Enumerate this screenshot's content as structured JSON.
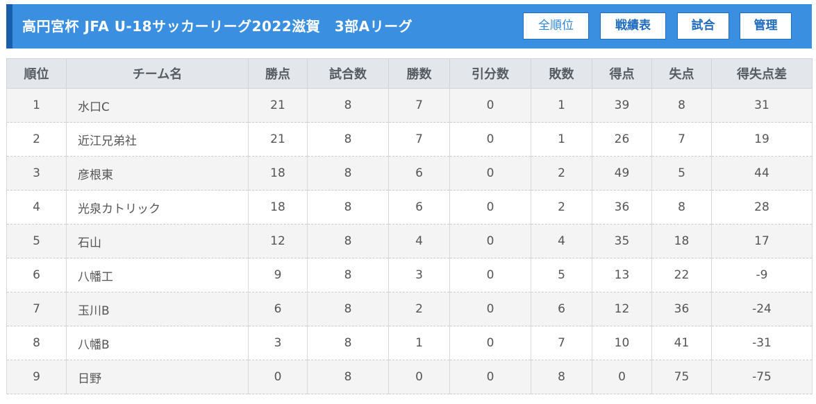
{
  "header": {
    "title": "高円宮杯 JFA U-18サッカーリーグ2022滋賀　3部Aリーグ",
    "nav": [
      "全順位",
      "戦績表",
      "試合",
      "管理"
    ]
  },
  "table": {
    "columns": [
      "順位",
      "チーム名",
      "勝点",
      "試合数",
      "勝数",
      "引分数",
      "敗数",
      "得点",
      "失点",
      "得失点差"
    ],
    "rows": [
      [
        "1",
        "水口C",
        "21",
        "8",
        "7",
        "0",
        "1",
        "39",
        "8",
        "31"
      ],
      [
        "2",
        "近江兄弟社",
        "21",
        "8",
        "7",
        "0",
        "1",
        "26",
        "7",
        "19"
      ],
      [
        "3",
        "彦根東",
        "18",
        "8",
        "6",
        "0",
        "2",
        "49",
        "5",
        "44"
      ],
      [
        "4",
        "光泉カトリック",
        "18",
        "8",
        "6",
        "0",
        "2",
        "36",
        "8",
        "28"
      ],
      [
        "5",
        "石山",
        "12",
        "8",
        "4",
        "0",
        "4",
        "35",
        "18",
        "17"
      ],
      [
        "6",
        "八幡工",
        "9",
        "8",
        "3",
        "0",
        "5",
        "13",
        "22",
        "-9"
      ],
      [
        "7",
        "玉川B",
        "6",
        "8",
        "2",
        "0",
        "6",
        "12",
        "36",
        "-24"
      ],
      [
        "8",
        "八幡B",
        "3",
        "8",
        "1",
        "0",
        "7",
        "10",
        "41",
        "-31"
      ],
      [
        "9",
        "日野",
        "0",
        "8",
        "0",
        "0",
        "8",
        "0",
        "75",
        "-75"
      ]
    ]
  },
  "colors": {
    "header_bg": "#3a8fe0",
    "header_accent": "#1a5faa",
    "nav_text": "#1f6bbf",
    "table_header_bg": "#e3e7ec",
    "row_alt_bg": "#f4f4f4"
  }
}
